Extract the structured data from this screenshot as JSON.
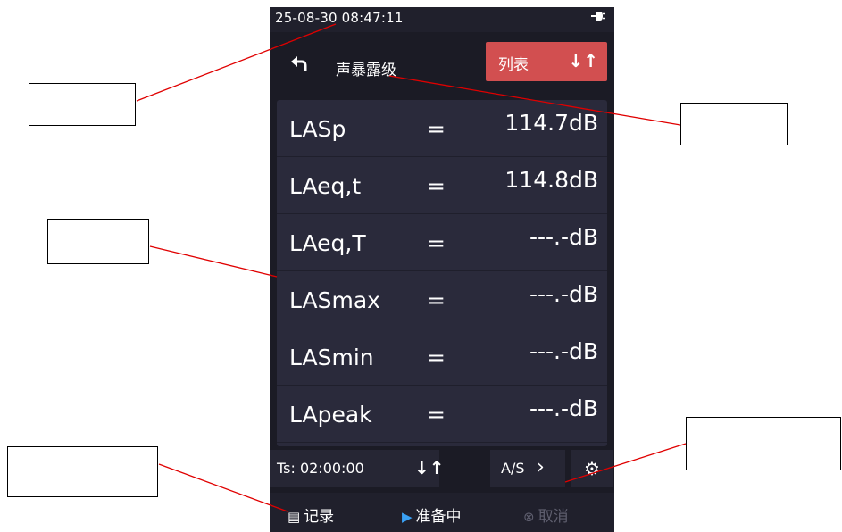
{
  "status_bar": {
    "datetime": "25-08-30 08:47:11",
    "power_icon": "plug-icon"
  },
  "header": {
    "back_icon": "back-arrow-icon",
    "title": "声暴露级",
    "view_button_label": "列表",
    "sort_icon": "sort-arrows-icon"
  },
  "measurements": [
    {
      "name": "LASp",
      "eq": "=",
      "value": "114.7dB"
    },
    {
      "name": "LAeq,t",
      "eq": "=",
      "value": "114.8dB"
    },
    {
      "name": "LAeq,T",
      "eq": "=",
      "value": "---.-dB"
    },
    {
      "name": "LASmax",
      "eq": "=",
      "value": "---.-dB"
    },
    {
      "name": "LASmin",
      "eq": "=",
      "value": "---.-dB"
    },
    {
      "name": "LApeak",
      "eq": "=",
      "value": "---.-dB"
    }
  ],
  "controls": {
    "ts_label": "Ts: 02:00:00",
    "weighting_label": "A/S",
    "settings_icon": "gear-icon"
  },
  "actions": {
    "record_label": "记录",
    "ready_label": "准备中",
    "cancel_label": "取消"
  },
  "colors": {
    "accent_red": "#d24f50",
    "ready_blue": "#3aa0f3",
    "background": "#1b1b25",
    "panel": "#2a2a3b"
  }
}
